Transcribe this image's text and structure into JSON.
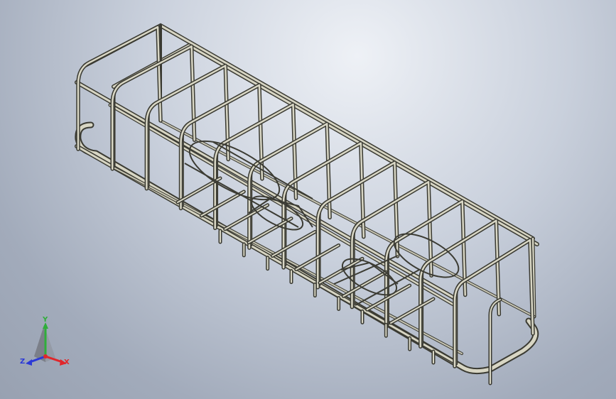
{
  "viewport": {
    "background_top": "#eef1f6",
    "background_bottom": "#98a1b1",
    "model_name": "tubular-frame-cage-3d-model"
  },
  "triad": {
    "x_label": "X",
    "y_label": "Y",
    "z_label": "Z",
    "x_color": "#e0262b",
    "y_color": "#2fae3a",
    "z_color": "#2b39d6"
  }
}
